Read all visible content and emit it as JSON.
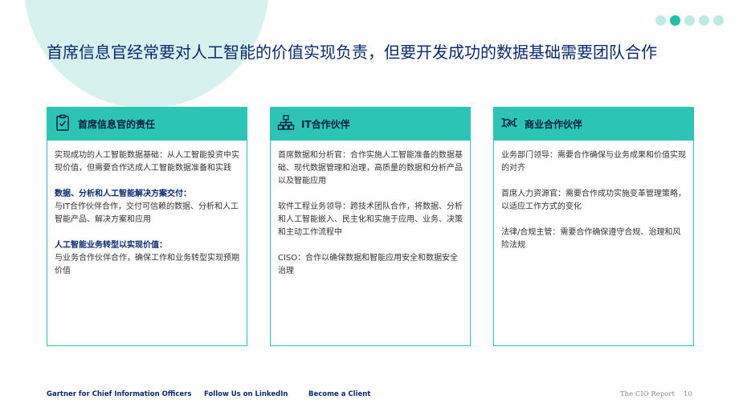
{
  "headline": "首席信息官经常要对人工智能的价值实现负责，但要开发成功的数据基础需要团队合作",
  "pagination": {
    "count": 5,
    "active_index": 1
  },
  "colors": {
    "accent": "#2bc4b5",
    "navy": "#0b2a6f",
    "light": "#d6f1ee"
  },
  "cards": [
    {
      "icon": "clipboard-check-icon",
      "title": "首席信息官的责任",
      "paragraphs": [
        {
          "title": "",
          "text": "实现成功的人工智能数据基础：从人工智能投资中实现价值，但需要合作达成人工智能数据准备和实践"
        },
        {
          "title": "数据、分析和人工智能解决方案交付：",
          "text": "与IT合作伙伴合作，交付可信赖的数据、分析和人工智能产品、解决方案和应用"
        },
        {
          "title": "人工智能业务转型以实现价值：",
          "text": "与业务合作伙伴合作，确保工作和业务转型实现预期价值"
        }
      ]
    },
    {
      "icon": "org-chart-icon",
      "title": "IT合作伙伴",
      "paragraphs": [
        {
          "title": "",
          "text": "首席数据和分析官：合作实施人工智能准备的数据基础、现代数据管理和治理，高质量的数据和分析产品以及智能应用"
        },
        {
          "title": "",
          "text": "软件工程业务领导：跨技术团队合作，将数据、分析和人工智能嵌入、民主化和实施于应用、业务、决策和主动工作流程中"
        },
        {
          "title": "",
          "text": "CISO：合作以确保数据和智能应用安全和数据安全治理"
        }
      ]
    },
    {
      "icon": "handshake-icon",
      "title": "商业合作伙伴",
      "paragraphs": [
        {
          "title": "",
          "text": "业务部门领导：需要合作确保与业务成果和价值实现的对齐"
        },
        {
          "title": "",
          "text": "首席人力资源官：需要合作成功实施变革管理策略，以适应工作方式的变化"
        },
        {
          "title": "",
          "text": "法律/合规主管：需要合作确保遵守合规、治理和风险法规"
        }
      ]
    }
  ],
  "footer": {
    "link1": "Gartner for Chief Information Officers",
    "link2": "Follow Us on LinkedIn",
    "link3": "Become a Client",
    "report": "The CIO Report",
    "page_number": "10"
  }
}
